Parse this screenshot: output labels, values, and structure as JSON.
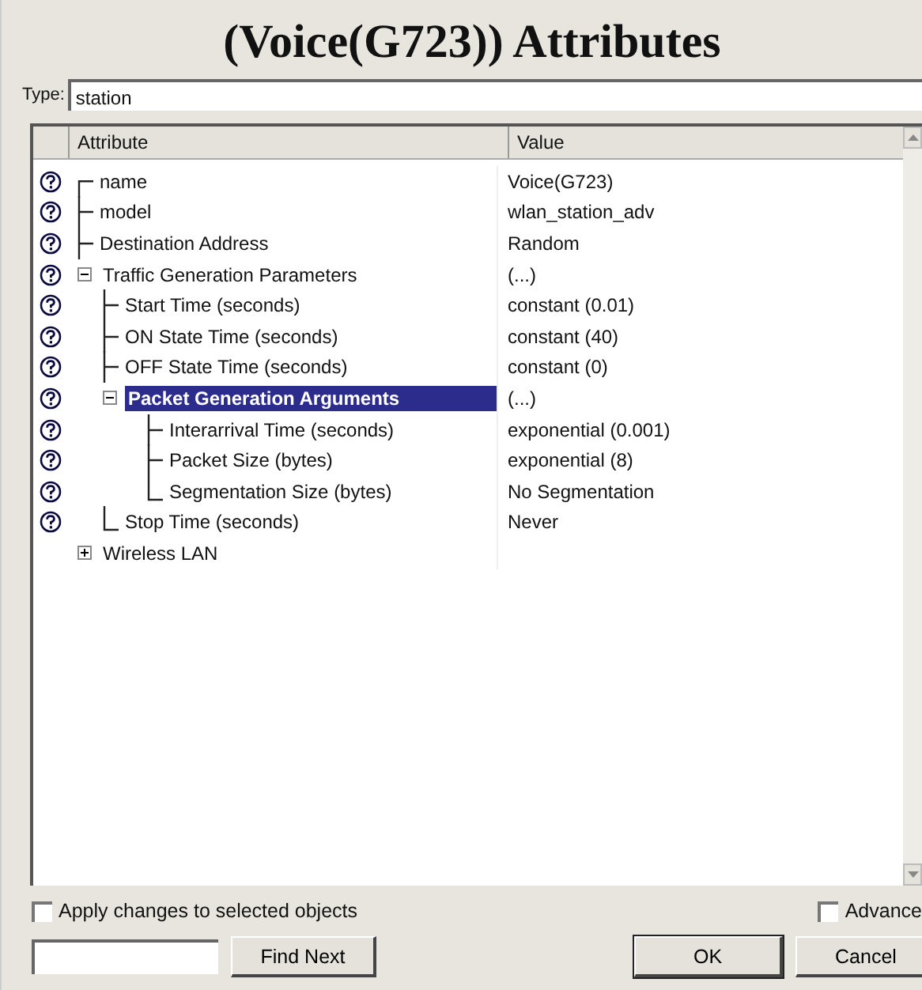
{
  "dialog": {
    "title": "(Voice(G723)) Attributes"
  },
  "type_field": {
    "label": "Type:",
    "value": "station"
  },
  "table": {
    "columns": [
      "Attribute",
      "Value"
    ],
    "rows": [
      {
        "name": "name",
        "value": "Voice(G723)",
        "help_icon": true,
        "selected": false
      },
      {
        "name": "model",
        "value": "wlan_station_adv",
        "help_icon": true,
        "selected": false
      },
      {
        "name": "Destination Address",
        "value": "Random",
        "help_icon": true,
        "selected": false
      },
      {
        "name": "Traffic Generation Parameters",
        "value": "(...)",
        "help_icon": true,
        "selected": false,
        "expanded": true,
        "children": [
          {
            "name": "Start Time (seconds)",
            "value": "constant (0.01)",
            "help_icon": true,
            "selected": false
          },
          {
            "name": "ON State Time (seconds)",
            "value": "constant (40)",
            "help_icon": true,
            "selected": false
          },
          {
            "name": "OFF State Time (seconds)",
            "value": "constant (0)",
            "help_icon": true,
            "selected": false
          },
          {
            "name": "Packet Generation Arguments",
            "value": "(...)",
            "help_icon": true,
            "selected": true,
            "expanded": true,
            "children": [
              {
                "name": "Interarrival Time (seconds)",
                "value": "exponential (0.001)",
                "help_icon": true,
                "selected": false
              },
              {
                "name": "Packet Size (bytes)",
                "value": "exponential (8)",
                "help_icon": true,
                "selected": false
              },
              {
                "name": "Segmentation Size (bytes)",
                "value": "No Segmentation",
                "help_icon": true,
                "selected": false
              }
            ]
          },
          {
            "name": "Stop Time (seconds)",
            "value": "Never",
            "help_icon": true,
            "selected": false
          }
        ]
      },
      {
        "name": "Wireless LAN",
        "help_icon": false,
        "selected": false,
        "expanded": false,
        "children": []
      }
    ]
  },
  "apply_checkbox": {
    "label": "Apply changes to selected objects",
    "checked": false
  },
  "advanced_checkbox": {
    "label": "Advance",
    "checked": false
  },
  "buttons": {
    "find_next": "Find Next",
    "ok": "OK",
    "cancel": "Cancel"
  }
}
